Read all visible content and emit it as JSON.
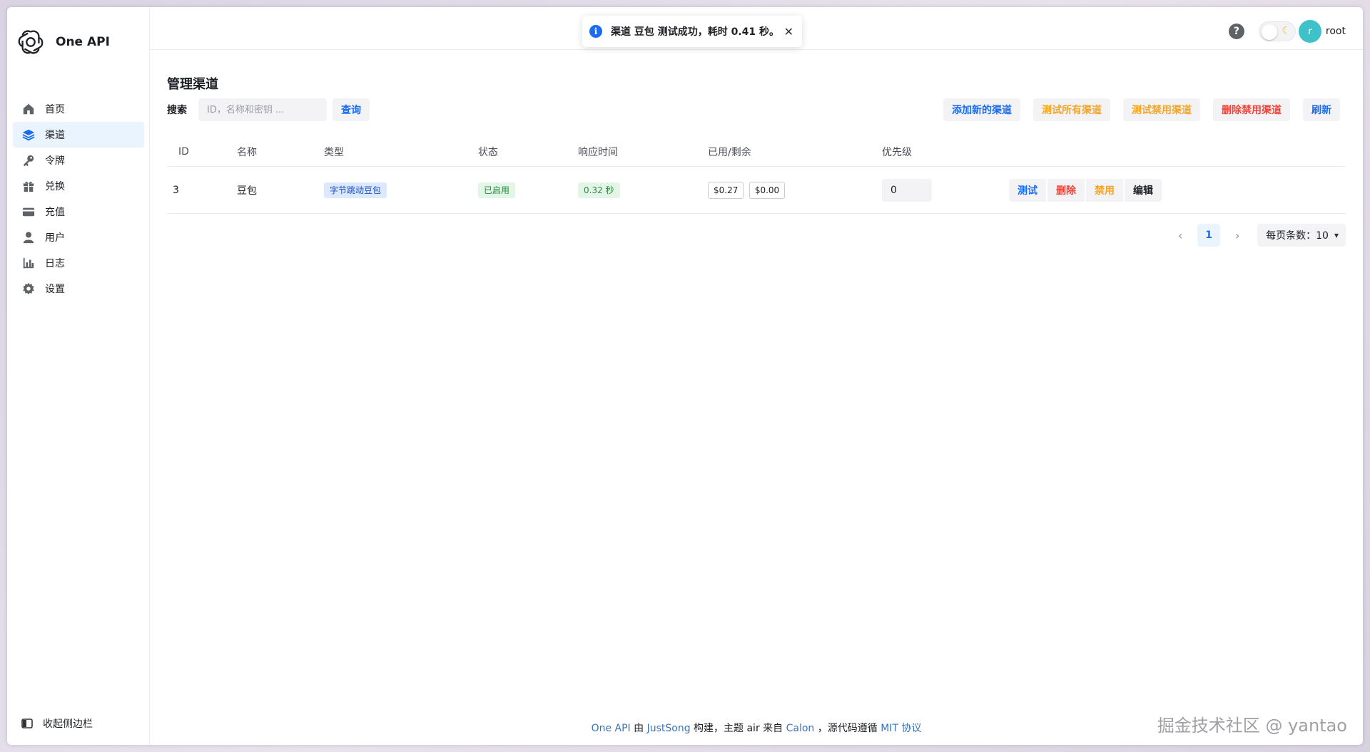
{
  "app": {
    "name": "One API"
  },
  "sidebar": {
    "items": [
      {
        "label": "首页",
        "icon": "home-icon",
        "active": false
      },
      {
        "label": "渠道",
        "icon": "layers-icon",
        "active": true
      },
      {
        "label": "令牌",
        "icon": "key-icon",
        "active": false
      },
      {
        "label": "兑换",
        "icon": "gift-icon",
        "active": false
      },
      {
        "label": "充值",
        "icon": "credit-card-icon",
        "active": false
      },
      {
        "label": "用户",
        "icon": "user-icon",
        "active": false
      },
      {
        "label": "日志",
        "icon": "bar-chart-icon",
        "active": false
      },
      {
        "label": "设置",
        "icon": "gear-icon",
        "active": false
      }
    ],
    "collapse_label": "收起侧边栏"
  },
  "header": {
    "help": "?",
    "avatar_letter": "r",
    "username": "root"
  },
  "toast": {
    "message": "渠道 豆包 测试成功，耗时 0.41 秒。",
    "close": "✕"
  },
  "page": {
    "title": "管理渠道",
    "search_label": "搜索",
    "search_placeholder": "ID，名称和密钥 ...",
    "search_button": "查询",
    "actions": {
      "add": "添加新的渠道",
      "test_all": "测试所有渠道",
      "test_disabled": "测试禁用渠道",
      "delete_disabled": "删除禁用渠道",
      "refresh": "刷新"
    }
  },
  "table": {
    "columns": [
      "ID",
      "名称",
      "类型",
      "状态",
      "响应时间",
      "已用/剩余",
      "优先级"
    ],
    "rows": [
      {
        "id": "3",
        "name": "豆包",
        "type": "字节跳动豆包",
        "status": "已启用",
        "response": "0.32 秒",
        "used": "$0.27",
        "remaining": "$0.00",
        "priority": "0",
        "ops": {
          "test": "测试",
          "delete": "删除",
          "disable": "禁用",
          "edit": "编辑"
        }
      }
    ]
  },
  "pagination": {
    "current": "1",
    "page_size_label": "每页条数：10"
  },
  "footer": {
    "link_oneapi": "One API",
    "text_by": " 由 ",
    "link_author": "JustSong",
    "text_mid": " 构建，主题 air 来自 ",
    "link_theme": "Calon",
    "text_license": " ，源代码遵循 ",
    "link_license": "MIT 协议"
  },
  "watermark": "掘金技术社区 @ yantao",
  "colors": {
    "primary": "#1a6cf2",
    "warning": "#f5a524",
    "danger": "#f04438",
    "success_bg": "#e3f5e6",
    "active_nav_bg": "#eaf4fe"
  }
}
